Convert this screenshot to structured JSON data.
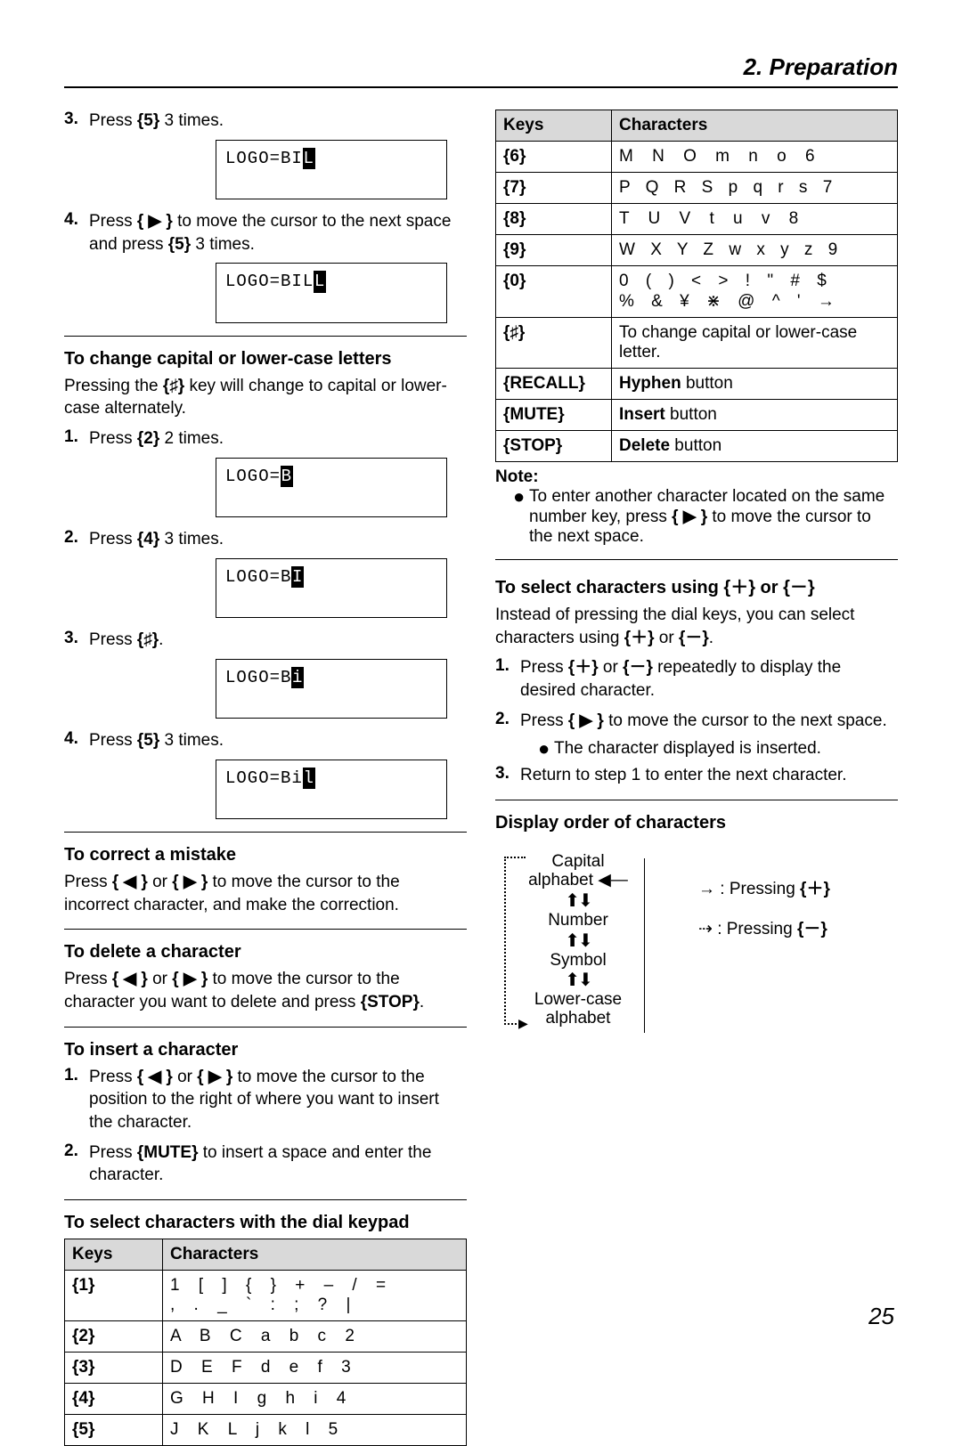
{
  "header": {
    "section": "2. Preparation"
  },
  "left": {
    "step3": {
      "num": "3.",
      "text_a": "Press ",
      "key": "{5}",
      "text_b": " 3 times."
    },
    "logo1": "LOGO=BI",
    "logo1_inv": "L",
    "step4": {
      "num": "4.",
      "text_a": "Press ",
      "key": "{ ▶ }",
      "text_b": " to move the cursor to the next space and press ",
      "key2": "{5}",
      "text_c": " 3 times."
    },
    "logo2": "LOGO=BIL",
    "logo2_inv": "L",
    "change_case_head": "To change capital or lower-case letters",
    "change_case_body_a": "Pressing the ",
    "change_case_key": "{♯}",
    "change_case_body_b": " key will change to capital or lower-case alternately.",
    "cc_step1": {
      "num": "1.",
      "text_a": "Press ",
      "key": "{2}",
      "text_b": " 2 times."
    },
    "cc_logo1": "LOGO=",
    "cc_logo1_inv": "B",
    "cc_step2": {
      "num": "2.",
      "text_a": "Press ",
      "key": "{4}",
      "text_b": " 3 times."
    },
    "cc_logo2": "LOGO=B",
    "cc_logo2_inv": "I",
    "cc_step3": {
      "num": "3.",
      "text_a": "Press ",
      "key": "{♯}",
      "text_b": "."
    },
    "cc_logo3": "LOGO=B",
    "cc_logo3_inv": "i",
    "cc_step4": {
      "num": "4.",
      "text_a": "Press ",
      "key": "{5}",
      "text_b": " 3 times."
    },
    "cc_logo4": "LOGO=Bi",
    "cc_logo4_inv": "l",
    "correct_head": "To correct a mistake",
    "correct_body_a": "Press ",
    "correct_key1": "{ ◀ }",
    "correct_body_b": " or ",
    "correct_key2": "{ ▶ }",
    "correct_body_c": " to move the cursor to the incorrect character, and make the correction.",
    "delete_head": "To delete a character",
    "delete_body_a": "Press ",
    "delete_key1": "{ ◀ }",
    "delete_body_b": " or ",
    "delete_key2": "{ ▶ }",
    "delete_body_c": " to move the cursor to the character you want to delete and press ",
    "delete_key3": "{STOP}",
    "delete_body_d": ".",
    "insert_head": "To insert a character",
    "ins_step1": {
      "num": "1.",
      "text_a": "Press ",
      "key1": "{ ◀ }",
      "text_b": " or ",
      "key2": "{ ▶ }",
      "text_c": " to move the cursor to the position to the right of where you want to insert the character."
    },
    "ins_step2": {
      "num": "2.",
      "text_a": "Press ",
      "key": "{MUTE}",
      "text_b": " to insert a space and enter the character."
    },
    "dial_head": "To select characters with the dial keypad",
    "table1": {
      "head_keys": "Keys",
      "head_chars": "Characters",
      "rows": [
        {
          "key": "{1}",
          "chars": "1 [ ] { } + – / =",
          "chars2": ", . _ ` : ; ? |"
        },
        {
          "key": "{2}",
          "chars": "A B C a b c 2"
        },
        {
          "key": "{3}",
          "chars": "D E F d e f 3"
        },
        {
          "key": "{4}",
          "chars": "G H I g h i 4"
        },
        {
          "key": "{5}",
          "chars": "J K L j k l 5"
        }
      ]
    }
  },
  "right": {
    "table2": {
      "head_keys": "Keys",
      "head_chars": "Characters",
      "rows": [
        {
          "key": "{6}",
          "chars": "M N O m n o 6"
        },
        {
          "key": "{7}",
          "chars": "P Q R S p q r s 7"
        },
        {
          "key": "{8}",
          "chars": "T U V t u v 8"
        },
        {
          "key": "{9}",
          "chars": "W X Y Z w x y z 9"
        },
        {
          "key": "{0}",
          "chars": "0 ( ) < > ! \" # $",
          "chars2": "% & ¥ ⋇ @ ^ ' →"
        },
        {
          "key": "{♯}",
          "text": "To change capital or lower-case letter."
        },
        {
          "key": "{RECALL}",
          "bold": "Hyphen",
          "after": " button"
        },
        {
          "key": "{MUTE}",
          "bold": "Insert",
          "after": " button"
        },
        {
          "key": "{STOP}",
          "bold": "Delete",
          "after": " button"
        }
      ]
    },
    "note_head": "Note:",
    "note_bullet_a": "To enter another character located on the same number key, press ",
    "note_key": "{ ▶ }",
    "note_bullet_b": " to move the cursor to the next space.",
    "plusminus_head_a": "To select characters using ",
    "plusminus_key1": "{＋}",
    "plusminus_head_b": " or ",
    "plusminus_key2": "{－}",
    "pm_body_a": "Instead of pressing the dial keys, you can select characters using ",
    "pm_body_key1": "{＋}",
    "pm_body_b": " or ",
    "pm_body_key2": "{－}",
    "pm_body_c": ".",
    "pm_step1": {
      "num": "1.",
      "text_a": "Press ",
      "key1": "{＋}",
      "text_b": " or ",
      "key2": "{－}",
      "text_c": " repeatedly to display the desired character."
    },
    "pm_step2": {
      "num": "2.",
      "text_a": "Press ",
      "key": "{ ▶ }",
      "text_b": " to move the cursor to the next space."
    },
    "pm_step2_bullet": "The character displayed is inserted.",
    "pm_step3": {
      "num": "3.",
      "text": "Return to step 1 to enter the next character."
    },
    "order_head": "Display order of characters",
    "diagram": {
      "capital": "Capital alphabet",
      "number": "Number",
      "symbol": "Symbol",
      "lower": "Lower-case alphabet",
      "legend_plus_a": "→ : Pressing ",
      "legend_plus_key": "{＋}",
      "legend_minus_a": "⇢ : Pressing ",
      "legend_minus_key": "{－}"
    }
  },
  "page_num": "25",
  "chart_data": {
    "type": "table",
    "title": "Dial keypad character mapping",
    "columns": [
      "Key",
      "Characters"
    ],
    "rows": [
      [
        "1",
        "1 [ ] { } + – / = , . _ ` : ; ? |"
      ],
      [
        "2",
        "A B C a b c 2"
      ],
      [
        "3",
        "D E F d e f 3"
      ],
      [
        "4",
        "G H I g h i 4"
      ],
      [
        "5",
        "J K L j k l 5"
      ],
      [
        "6",
        "M N O m n o 6"
      ],
      [
        "7",
        "P Q R S p q r s 7"
      ],
      [
        "8",
        "T U V t u v 8"
      ],
      [
        "9",
        "W X Y Z w x y z 9"
      ],
      [
        "0",
        "0 ( ) < > ! \" # $ % & ¥ * @ ^ ' →"
      ],
      [
        "♯",
        "To change capital or lower-case letter."
      ],
      [
        "RECALL",
        "Hyphen button"
      ],
      [
        "MUTE",
        "Insert button"
      ],
      [
        "STOP",
        "Delete button"
      ]
    ]
  }
}
